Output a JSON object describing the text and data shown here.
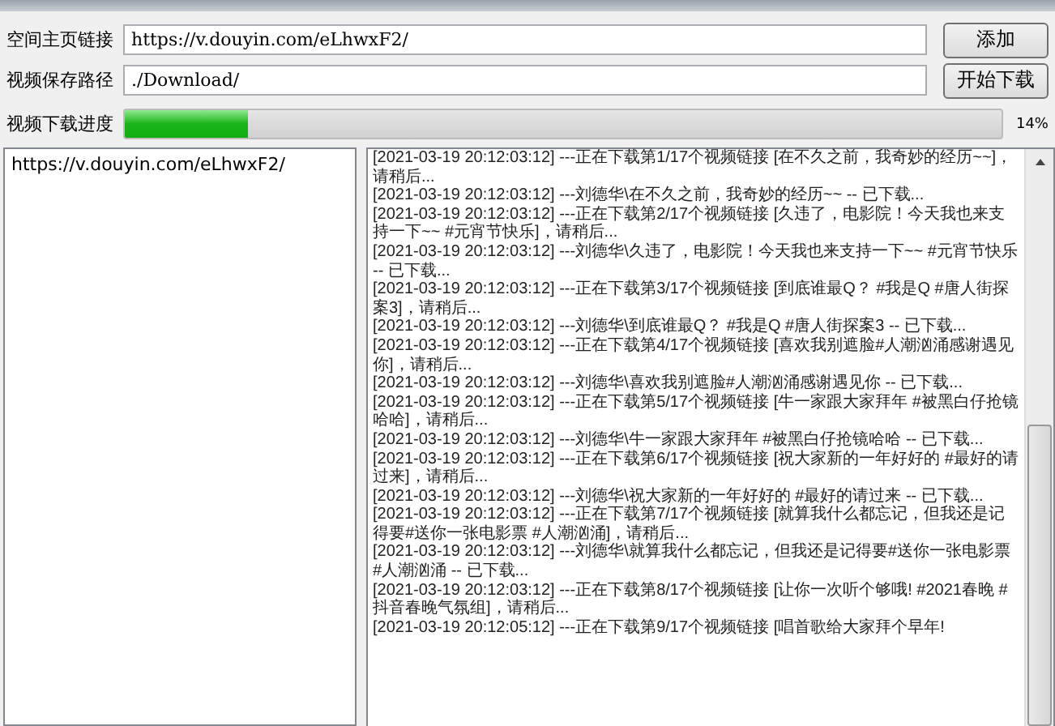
{
  "form": {
    "fields": [
      {
        "label": "空间主页链接",
        "value": "https://v.douyin.com/eLhwxF2/",
        "button": "添加"
      },
      {
        "label": "视频保存路径",
        "value": "./Download/",
        "button": "开始下载"
      }
    ],
    "progress": {
      "label": "视频下载进度",
      "level": 0.14,
      "reading": "14%"
    }
  },
  "link_list": {
    "items": [
      "https://v.douyin.com/eLhwxF2/"
    ]
  },
  "log": {
    "entries": [
      "[2021-03-19 20:12:03:12] ---正在下载第1/17个视频链接 [在不久之前，我奇妙的经历~~]，请稍后...",
      "[2021-03-19 20:12:03:12] ---刘德华\\在不久之前，我奇妙的经历~~ -- 已下载...",
      "[2021-03-19 20:12:03:12] ---正在下载第2/17个视频链接 [久违了，电影院！今天我也来支持一下~~ #元宵节快乐]，请稍后...",
      "[2021-03-19 20:12:03:12] ---刘德华\\久违了，电影院！今天我也来支持一下~~ #元宵节快乐 -- 已下载...",
      "[2021-03-19 20:12:03:12] ---正在下载第3/17个视频链接 [到底谁最Q？ #我是Q #唐人街探案3]，请稍后...",
      "[2021-03-19 20:12:03:12] ---刘德华\\到底谁最Q？ #我是Q #唐人街探案3 -- 已下载...",
      "[2021-03-19 20:12:03:12] ---正在下载第4/17个视频链接 [喜欢我别遮脸#人潮汹涌感谢遇见你]，请稍后...",
      "[2021-03-19 20:12:03:12] ---刘德华\\喜欢我别遮脸#人潮汹涌感谢遇见你 -- 已下载...",
      "[2021-03-19 20:12:03:12] ---正在下载第5/17个视频链接 [牛一家跟大家拜年 #被黑白仔抢镜哈哈]，请稍后...",
      "[2021-03-19 20:12:03:12] ---刘德华\\牛一家跟大家拜年 #被黑白仔抢镜哈哈 -- 已下载...",
      "[2021-03-19 20:12:03:12] ---正在下载第6/17个视频链接 [祝大家新的一年好好的 #最好的请过来]，请稍后...",
      "[2021-03-19 20:12:03:12] ---刘德华\\祝大家新的一年好好的 #最好的请过来 -- 已下载...",
      "[2021-03-19 20:12:03:12] ---正在下载第7/17个视频链接 [就算我什么都忘记，但我还是记得要#送你一张电影票 #人潮汹涌]，请稍后...",
      "[2021-03-19 20:12:03:12] ---刘德华\\就算我什么都忘记，但我还是记得要#送你一张电影票 #人潮汹涌 -- 已下载...",
      "[2021-03-19 20:12:03:12] ---正在下载第8/17个视频链接 [让你一次听个够哦! #2021春晚 #抖音春晚气氛组]，请稍后...",
      "[2021-03-19 20:12:05:12] ---正在下载第9/17个视频链接 [唱首歌给大家拜个早年!"
    ]
  }
}
